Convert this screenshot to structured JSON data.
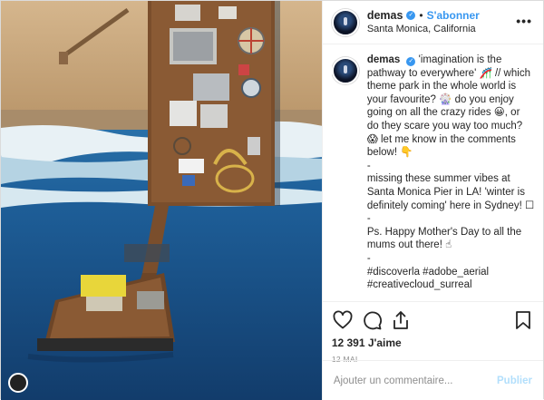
{
  "post": {
    "username": "demas",
    "follow_label": "S'abonner",
    "dot": "•",
    "location": "Santa Monica, California",
    "more_icon": "ellipsis-icon"
  },
  "caption": {
    "username": "demas",
    "lines": [
      "'imagination is the",
      "pathway to everywhere' 🎢 // which",
      "theme park in the whole world is",
      "your favourite? 🎡 do you enjoy",
      "going on all the crazy rides 😀, or",
      "do they scare you way too much?",
      "😱 let me know in the comments",
      "below! 👇",
      "-",
      "missing these summer vibes at",
      "Santa Monica Pier in LA! 'winter is",
      "definitely coming' here in Sydney! ☐",
      "-",
      "Ps. Happy Mother's Day to all the",
      "mums out there! ☝",
      "-",
      "#discoverla #adobe_aerial",
      "#creativecloud_surreal",
      ".",
      "."
    ]
  },
  "actions": {
    "like_icon": "heart-icon",
    "comment_icon": "comment-bubble-icon",
    "share_icon": "share-icon",
    "save_icon": "bookmark-icon",
    "likes": "12 391 J'aime",
    "date": "12 MAI"
  },
  "comment": {
    "placeholder": "Ajouter un commentaire...",
    "publish_label": "Publier"
  },
  "colors": {
    "accent": "#3897f0",
    "publish_disabled": "#b2dffc",
    "ocean": "#1f5b92",
    "sand": "#c9a77d",
    "pier": "#7a4e2c"
  }
}
